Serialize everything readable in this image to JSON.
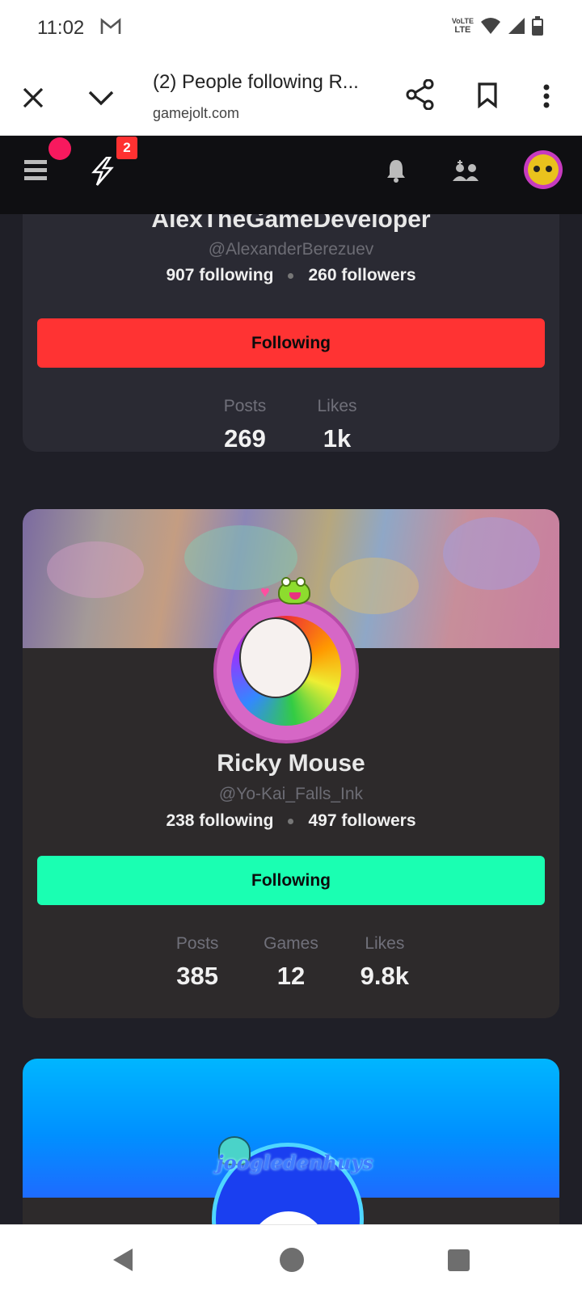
{
  "status_bar": {
    "time": "11:02",
    "network_label": "VoLTE",
    "network_sublabel": "LTE"
  },
  "browser": {
    "title": "(2) People following R...",
    "url": "gamejolt.com"
  },
  "gj_nav": {
    "activity_badge": "2"
  },
  "users": [
    {
      "name": "AlexTheGameDeveloper",
      "handle": "@AlexanderBerezuev",
      "following": "907 following",
      "followers": "260 followers",
      "follow_label": "Following",
      "button_color": "#ff3333",
      "stats": [
        {
          "label": "Posts",
          "value": "269"
        },
        {
          "label": "Likes",
          "value": "1k"
        }
      ]
    },
    {
      "name": "Ricky Mouse",
      "handle": "@Yo-Kai_Falls_Ink",
      "following": "238 following",
      "followers": "497 followers",
      "follow_label": "Following",
      "button_color": "#1affb2",
      "stats": [
        {
          "label": "Posts",
          "value": "385"
        },
        {
          "label": "Games",
          "value": "12"
        },
        {
          "label": "Likes",
          "value": "9.8k"
        }
      ]
    },
    {
      "avatar_text": "joogledenhuys"
    }
  ],
  "colors": {
    "nav_bg": "#0f0f12",
    "page_bg": "#1f1f27",
    "accent_red": "#ff3333",
    "accent_green": "#1affb2",
    "notification_dot": "#f7195e"
  }
}
